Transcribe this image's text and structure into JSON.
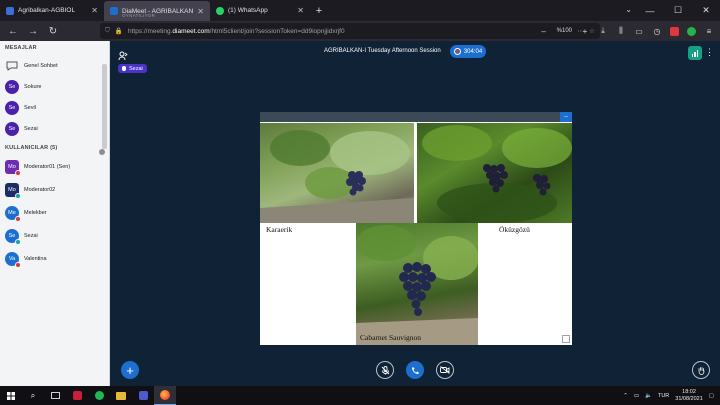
{
  "browser": {
    "tabs": [
      {
        "title": "Agribalkan-AGBIOL",
        "subtitle": "",
        "favicon_color": "#3b6fd6"
      },
      {
        "title": "DiaMeet - AGRIBALKAN-I Tuesday",
        "subtitle": "OYNATILIYOR",
        "favicon_color": "#1d6fcf"
      },
      {
        "title": "(1) WhatsApp",
        "subtitle": "",
        "favicon_color": "#25d366"
      }
    ],
    "new_tab": "+",
    "url_prefix": "https://meeting.",
    "url_host": "diameet.com",
    "url_rest": "/html5client/join?sessionToken=dd9iopnjjidxrjf0",
    "zoom": "%100"
  },
  "sidebar": {
    "messages_title": "MESAJLAR",
    "public_chat": "Genel Sohbet",
    "chat_users": [
      {
        "initials": "Se",
        "name": "Sokure"
      },
      {
        "initials": "Se",
        "name": "Sevil"
      },
      {
        "initials": "Se",
        "name": "Sezai"
      }
    ],
    "users_title": "KULLANICILAR (5)",
    "users": [
      {
        "initials": "Mo",
        "name": "Moderator01 (Sen)"
      },
      {
        "initials": "Mo",
        "name": "Moderator02"
      },
      {
        "initials": "Me",
        "name": "Melekber"
      },
      {
        "initials": "Se",
        "name": "Sezai"
      },
      {
        "initials": "Va",
        "name": "Valentina"
      }
    ]
  },
  "meeting": {
    "title": "AGRIBALKAN-I Tuesday Afternoon Session",
    "recording_time": "304:04",
    "presenter": "Sezai"
  },
  "slide": {
    "captions": [
      "Karaerik",
      "Öküzgözü",
      "Cabarnet Sauvignon"
    ]
  },
  "taskbar": {
    "lang": "TUR",
    "time": "18:02",
    "date": "31/08/2021"
  }
}
